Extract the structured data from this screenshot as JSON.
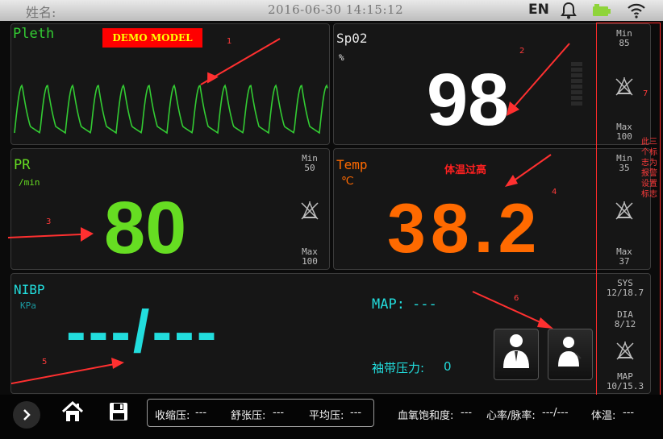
{
  "topbar": {
    "patient_label": "姓名:",
    "datetime": "2016-06-30  14:15:12",
    "language": "EN"
  },
  "pleth": {
    "label": "Pleth",
    "demo_badge": "DEMO MODEL",
    "colors": {
      "wave": "#33cc33",
      "label": "#33cc33",
      "badge_bg": "#ff0000",
      "badge_fg": "#ffff00"
    }
  },
  "spo2": {
    "label": "Sp02",
    "unit": "%",
    "value": "98",
    "alarm": {
      "min_label": "Min",
      "min_value": "85",
      "max_label": "Max",
      "max_value": "100"
    }
  },
  "pr": {
    "label": "PR",
    "unit": "/min",
    "value": "80",
    "alarm": {
      "min_label": "Min",
      "min_value": "50",
      "max_label": "Max",
      "max_value": "100"
    },
    "color": "#66dd22"
  },
  "temp": {
    "label": "Temp",
    "unit": "℃",
    "value": "38.2",
    "warning": "体温过高",
    "alarm": {
      "min_label": "Min",
      "min_value": "35",
      "max_label": "Max",
      "max_value": "37"
    },
    "color": "#ff6a00"
  },
  "nibp": {
    "label": "NIBP",
    "unit": "KPa",
    "value": "---/---",
    "map_label": "MAP:",
    "map_value": "---",
    "cuff_label": "袖带压力:",
    "cuff_value": "0",
    "alarm": {
      "sys_label": "SYS",
      "sys_value": "12/18.7",
      "dia_label": "DIA",
      "dia_value": "8/12",
      "map_label": "MAP",
      "map_value": "10/15.3"
    },
    "color": "#22dddd"
  },
  "annotations": {
    "n1": "1",
    "n2": "2",
    "n3": "3",
    "n4": "4",
    "n5": "5",
    "n6": "6",
    "n7": "7",
    "note7": "此三个标志为报警设置标志"
  },
  "bottom": {
    "summary": [
      {
        "label": "收缩压:",
        "value": "---"
      },
      {
        "label": "舒张压:",
        "value": "---"
      },
      {
        "label": "平均压:",
        "value": "---"
      }
    ],
    "status": [
      {
        "label": "血氧饱和度:",
        "value": "---"
      },
      {
        "label": "心率/脉率:",
        "value": "---/---"
      },
      {
        "label": "体温:",
        "value": "---"
      }
    ]
  },
  "icons": [
    "bell-icon",
    "battery-icon",
    "wifi-icon",
    "alarm-off-icon",
    "home-icon",
    "save-icon",
    "expand-arrow-icon",
    "person-icon"
  ]
}
